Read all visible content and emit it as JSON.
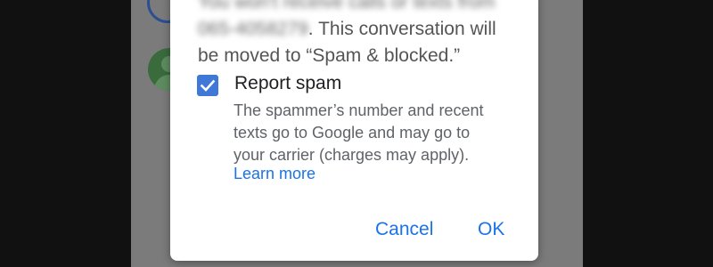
{
  "dialog": {
    "message_lines": [
      "You won't receive calls or texts from",
      "065-4058279. This conversation will",
      "be moved to “Spam & blocked.”"
    ],
    "blurred_prefix": "You won't receive calls or texts from",
    "blurred_number": "065-4058279",
    "message_line2_rest": ". This conversation will",
    "message_line3": "be moved to “Spam & blocked.”",
    "report_spam": {
      "label": "Report spam",
      "checked": true,
      "description_lines": [
        "The spammer’s number and recent",
        "texts go to Google and may go to",
        "your carrier (charges may apply)."
      ],
      "learn_more": "Learn more"
    },
    "buttons": {
      "cancel": "Cancel",
      "ok": "OK"
    }
  },
  "colors": {
    "accent": "#1a73e8",
    "checkbox": "#3f78d6",
    "scrim": "#7b7b7b",
    "frame": "#111111"
  },
  "icons": {
    "checkbox": "check-icon",
    "background_avatar": "person-icon"
  }
}
